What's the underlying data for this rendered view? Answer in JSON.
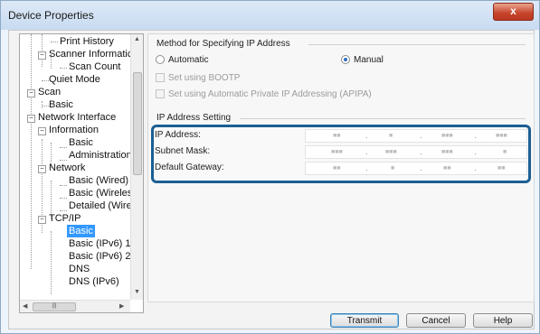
{
  "window": {
    "title": "Device Properties",
    "close_label": "x"
  },
  "tree": {
    "items": [
      {
        "label": "Print History"
      },
      {
        "label": "Scanner Informatic"
      },
      {
        "label": "Scan Count"
      },
      {
        "label": "Quiet Mode"
      },
      {
        "label": "Scan"
      },
      {
        "label": "Basic"
      },
      {
        "label": "Network Interface"
      },
      {
        "label": "Information"
      },
      {
        "label": "Basic"
      },
      {
        "label": "Administration I"
      },
      {
        "label": "Network"
      },
      {
        "label": "Basic (Wired)"
      },
      {
        "label": "Basic (Wireless)"
      },
      {
        "label": "Detailed (Wirele"
      },
      {
        "label": "TCP/IP"
      },
      {
        "label": "Basic"
      },
      {
        "label": "Basic (IPv6) 1"
      },
      {
        "label": "Basic (IPv6) 2"
      },
      {
        "label": "DNS"
      },
      {
        "label": "DNS (IPv6)"
      }
    ],
    "selected_index": 15
  },
  "method": {
    "group_label": "Method for Specifying IP Address",
    "automatic_label": "Automatic",
    "manual_label": "Manual",
    "selected": "manual",
    "bootp_label": "Set using BOOTP",
    "apipa_label": "Set using Automatic Private IP Addressing (APIPA)"
  },
  "ip_setting": {
    "group_label": "IP Address Setting",
    "rows": [
      {
        "label": "IP Address:"
      },
      {
        "label": "Subnet Mask:"
      },
      {
        "label": "Default Gateway:"
      }
    ]
  },
  "buttons": {
    "transmit": "Transmit",
    "cancel": "Cancel",
    "help": "Help"
  },
  "colors": {
    "highlight_border": "#1b5f93",
    "selected_bg": "#3399ff",
    "close_button": "#c7432a"
  }
}
